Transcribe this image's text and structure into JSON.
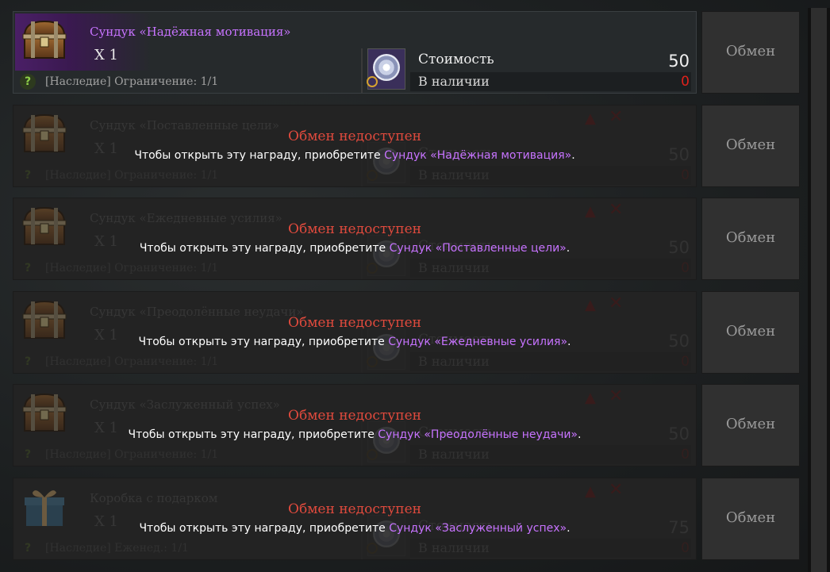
{
  "exchange": {
    "cost_label": "Стоимость",
    "stock_label": "В наличии",
    "button_label": "Обмен",
    "locked_title": "Обмен недоступен",
    "locked_prefix": "Чтобы открыть эту награду, приобретите"
  },
  "items": [
    {
      "name": "Сундук «Надёжная мотивация»",
      "qty": "X 1",
      "limit": "[Наследие] Ограничение: 1/1",
      "cost": "50",
      "stock": "0",
      "locked": false,
      "required": ""
    },
    {
      "name": "Сундук «Поставленные цели»",
      "qty": "X 1",
      "limit": "[Наследие] Ограничение: 1/1",
      "cost": "50",
      "stock": "0",
      "locked": true,
      "required": "Сундук «Надёжная мотивация»"
    },
    {
      "name": "Сундук «Ежедневные усилия»",
      "qty": "X 1",
      "limit": "[Наследие] Ограничение: 1/1",
      "cost": "50",
      "stock": "0",
      "locked": true,
      "required": "Сундук «Поставленные цели»"
    },
    {
      "name": "Сундук «Преодолённые неудачи»",
      "qty": "X 1",
      "limit": "[Наследие] Ограничение: 1/1",
      "cost": "50",
      "stock": "0",
      "locked": true,
      "required": "Сундук «Ежедневные усилия»"
    },
    {
      "name": "Сундук «Заслуженный успех»",
      "qty": "X 1",
      "limit": "[Наследие] Ограничение: 1/1",
      "cost": "50",
      "stock": "0",
      "locked": true,
      "required": "Сундук «Преодолённые неудачи»"
    },
    {
      "name": "Коробка с подарком",
      "qty": "X 1",
      "limit": "[Наследие] Еженед.: 1/1",
      "cost": "75",
      "stock": "0",
      "locked": true,
      "required": "Сундук «Заслуженный успех»"
    }
  ],
  "icons": {
    "chest": "treasure-chest-icon",
    "gift": "gift-box-icon",
    "currency": "silver-coin-icon",
    "help": "question-icon",
    "warning": "warning-icon",
    "close": "close-icon"
  },
  "colors": {
    "item_name": "#c773ff",
    "locked_title": "#e04a3d",
    "stock_zero": "#e0211b"
  }
}
